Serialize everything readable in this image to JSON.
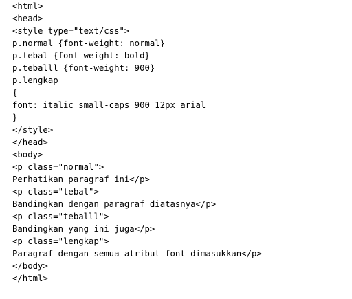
{
  "code": {
    "lines": [
      "<html>",
      "<head>",
      "<style type=\"text/css\">",
      "p.normal {font-weight: normal}",
      "p.tebal {font-weight: bold}",
      "p.teballl {font-weight: 900}",
      "p.lengkap",
      "{",
      "font: italic small-caps 900 12px arial",
      "}",
      "</style>",
      "</head>",
      "<body>",
      "<p class=\"normal\">",
      "Perhatikan paragraf ini</p>",
      "<p class=\"tebal\">",
      "Bandingkan dengan paragraf diatasnya</p>",
      "<p class=\"teballl\">",
      "Bandingkan yang ini juga</p>",
      "<p class=\"lengkap\">",
      "Paragraf dengan semua atribut font dimasukkan</p>",
      "</body>",
      "</html>"
    ]
  }
}
